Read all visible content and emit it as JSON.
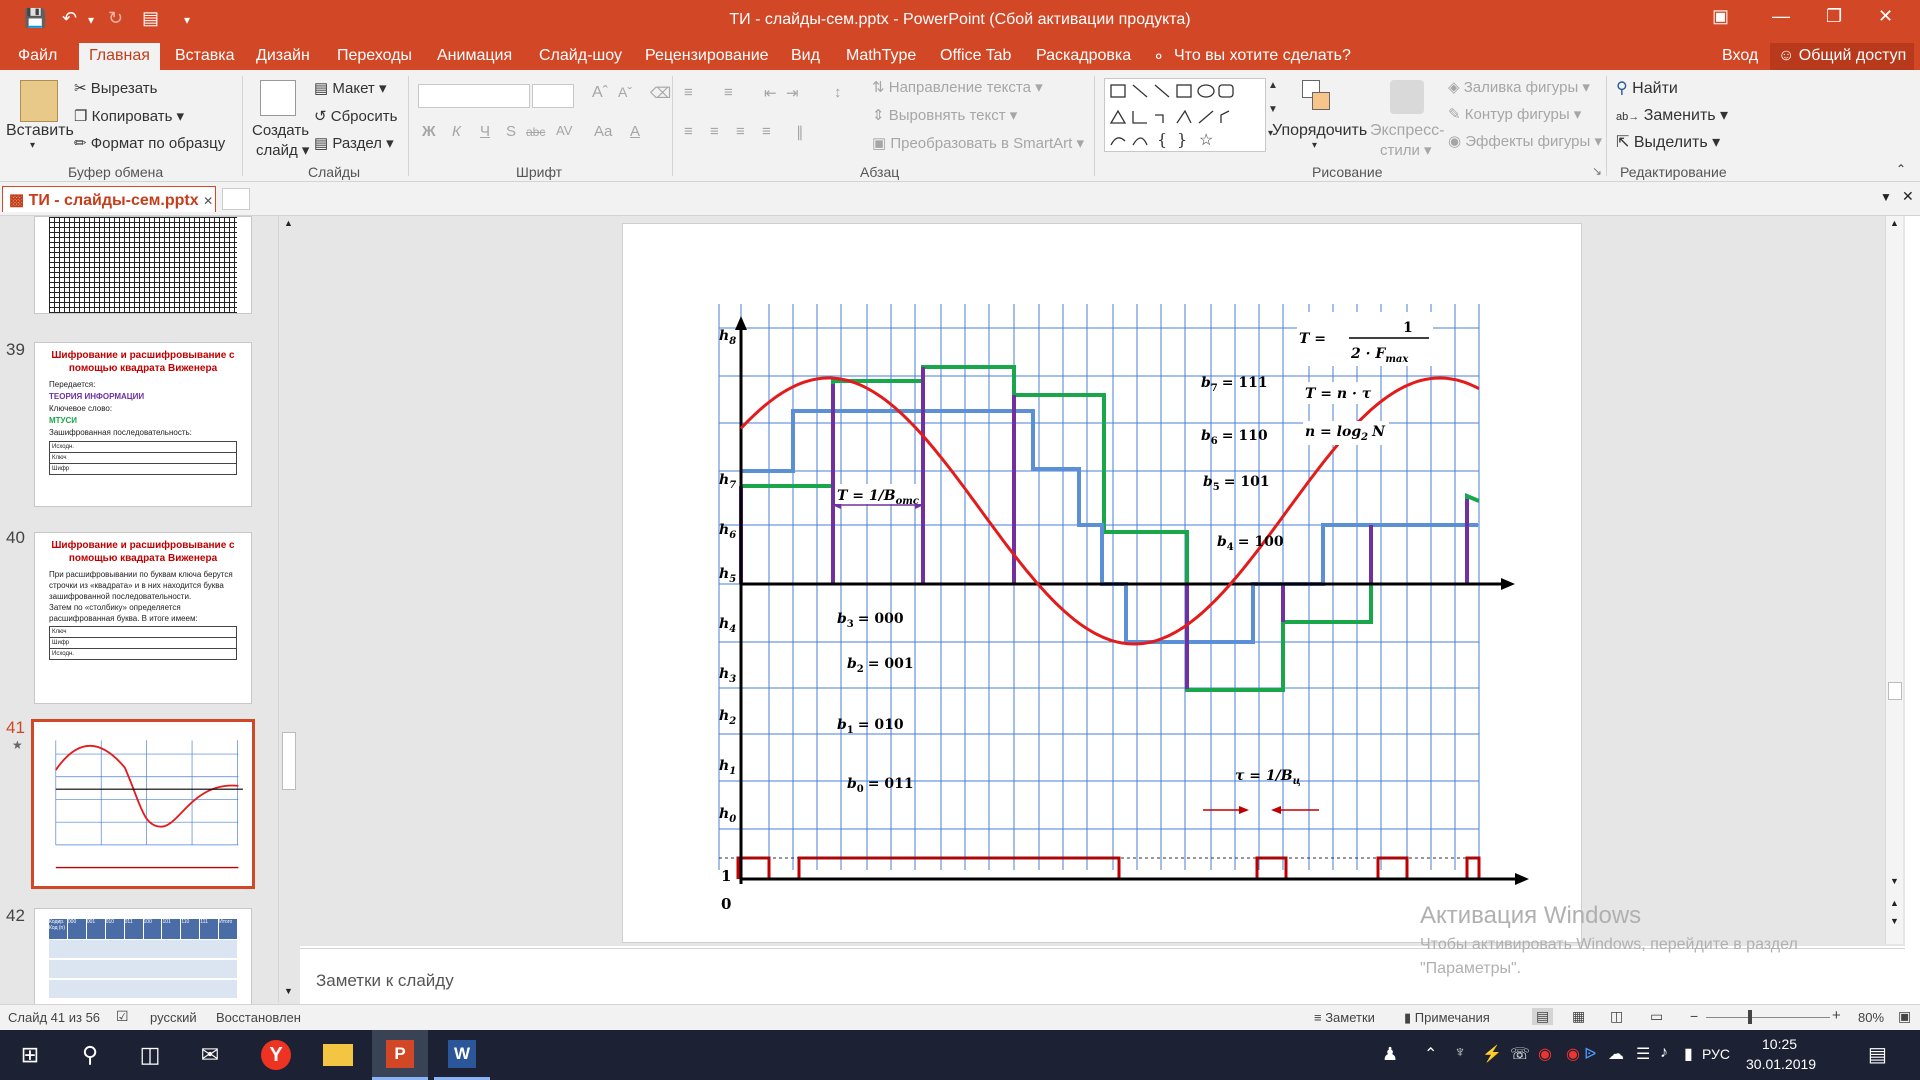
{
  "window": {
    "title": "ТИ - слайды-сем.pptx - PowerPoint (Сбой активации продукта)"
  },
  "ribbon_tabs": [
    "Файл",
    "Главная",
    "Вставка",
    "Дизайн",
    "Переходы",
    "Анимация",
    "Слайд-шоу",
    "Рецензирование",
    "Вид",
    "MathType",
    "Office Tab",
    "Раскадровка"
  ],
  "tell_me": "Что вы хотите сделать?",
  "login": "Вход",
  "share": "Общий доступ",
  "ribbon": {
    "clipboard": {
      "paste": "Вставить",
      "cut": "Вырезать",
      "copy": "Копировать",
      "format_painter": "Формат по образцу",
      "label": "Буфер обмена"
    },
    "slides": {
      "new_slide": "Создать",
      "new_slide2": "слайд",
      "layout": "Макет",
      "reset": "Сбросить",
      "section": "Раздел",
      "label": "Слайды"
    },
    "font": {
      "label": "Шрифт",
      "bold": "Ж",
      "italic": "К",
      "underline": "Ч",
      "strike": "abc",
      "spacing": "AV",
      "case": "Aa"
    },
    "paragraph": {
      "text_direction": "Направление текста",
      "align_text": "Выровнять текст",
      "smartart": "Преобразовать в SmartArt",
      "label": "Абзац"
    },
    "drawing": {
      "arrange": "Упорядочить",
      "quick_styles": "Экспресс-",
      "quick_styles2": "стили",
      "fill": "Заливка фигуры",
      "outline": "Контур фигуры",
      "effects": "Эффекты фигуры",
      "label": "Рисование"
    },
    "editing": {
      "find": "Найти",
      "replace": "Заменить",
      "select": "Выделить",
      "label": "Редактирование"
    }
  },
  "doc_tab": "ТИ - слайды-сем.pptx",
  "thumbnails": {
    "s39": {
      "num": "39",
      "title": "Шифрование и расшифровывание с помощью квадрата  Виженера",
      "l1": "Передается:",
      "l2": "ТЕОРИЯ ИНФОРМАЦИИ",
      "l3": "Ключевое слово:",
      "l4": "МТУСИ",
      "l5": "Зашифрованная последовательность:",
      "r1": "Исходн.",
      "r2": "Ключ",
      "r3": "Шифр"
    },
    "s40": {
      "num": "40",
      "title": "Шифрование и расшифровывание с помощью квадрата  Виженера",
      "l1": "При расшифровывании по буквам ключа берутся строчки из «квадрата» и в них находится буква зашифрованной последовательности.",
      "l2": "Затем по «столбику» определяется расшифрованная буква. В итоге имеем:",
      "r1": "Ключ",
      "r2": "Шифр",
      "r3": "Исходн."
    },
    "s41": {
      "num": "41",
      "star": "★"
    },
    "s42": {
      "num": "42",
      "h0": "Кодир. Код (n)",
      "h1": "000",
      "h2": "001",
      "h3": "010",
      "h4": "011",
      "h5": "100",
      "h6": "101",
      "h7": "110",
      "h8": "111",
      "h9": "Итого"
    }
  },
  "slide": {
    "h_labels": [
      "h",
      "h",
      "h",
      "h",
      "h",
      "h",
      "h",
      "h",
      "h"
    ],
    "h_subs": [
      "0",
      "1",
      "2",
      "3",
      "4",
      "5",
      "6",
      "7",
      "8"
    ],
    "codes": [
      {
        "b": "b",
        "sub": "7",
        "val": "= 111"
      },
      {
        "b": "b",
        "sub": "6",
        "val": "= 110"
      },
      {
        "b": "b",
        "sub": "5",
        "val": "= 101"
      },
      {
        "b": "b",
        "sub": "4",
        "val": "= 100"
      },
      {
        "b": "b",
        "sub": "3",
        "val": "= 000"
      },
      {
        "b": "b",
        "sub": "2",
        "val": "= 001"
      },
      {
        "b": "b",
        "sub": "1",
        "val": "= 010"
      },
      {
        "b": "b",
        "sub": "0",
        "val": "= 011"
      }
    ],
    "formula_T_num": "1",
    "formula_T_lhs": "T =",
    "formula_T_den": "2 · F",
    "formula_T_den_sub": "max",
    "formula_Tn": "T = n · τ",
    "formula_n": "n = log",
    "formula_n_sub": "2",
    "formula_n_end": "N",
    "period_lhs": "T = 1/B",
    "period_sub": "отс",
    "tau_lhs": "τ = 1/B",
    "tau_sub": "ц",
    "bit_one": "1",
    "bit_zero": "0"
  },
  "notes_placeholder": "Заметки к слайду",
  "watermark": {
    "title": "Активация Windows",
    "line1": "Чтобы активировать Windows, перейдите в раздел",
    "line2": "\"Параметры\"."
  },
  "status": {
    "slide": "Слайд 41 из 56",
    "lang": "русский",
    "restored": "Восстановлен",
    "notes": "Заметки",
    "comments": "Примечания",
    "zoom": "80%"
  },
  "taskbar": {
    "lang": "РУС",
    "time": "10:25",
    "date": "30.01.2019"
  },
  "colors": {
    "accent": "#d24726",
    "grid": "#4a7fd4",
    "sine": "#e31b1b",
    "green": "#1aa64b",
    "blue": "#5b8fd6",
    "purple": "#7030a0",
    "pulse": "#c00000"
  }
}
